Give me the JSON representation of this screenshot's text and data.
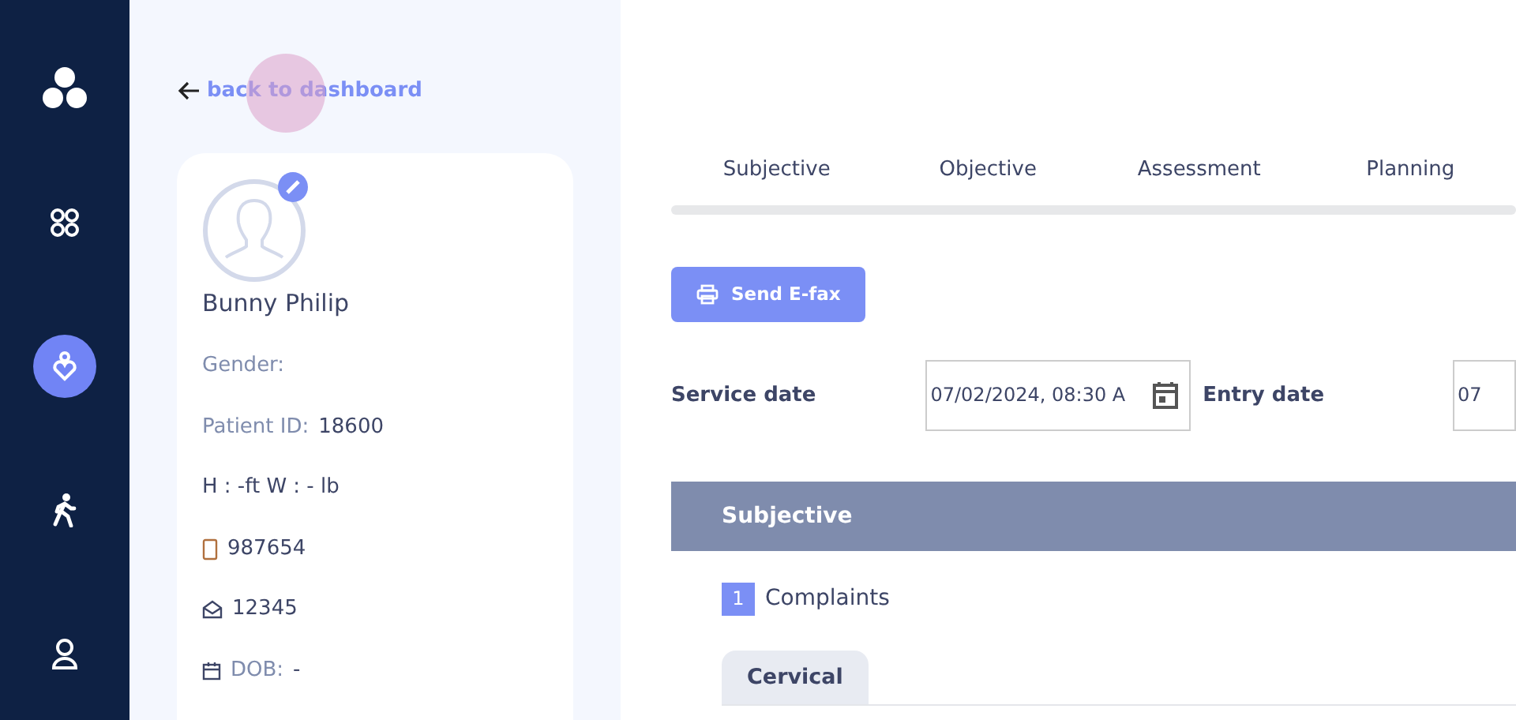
{
  "nav_rail": {
    "items": [
      {
        "kind": "grid",
        "selected": false
      },
      {
        "kind": "patient",
        "selected": true
      },
      {
        "kind": "walk",
        "selected": false
      },
      {
        "kind": "user",
        "selected": false
      }
    ]
  },
  "back_link": {
    "label": "back to dashboard",
    "click_indicator": true
  },
  "patient_card": {
    "name": "Bunny Philip",
    "gender_label": "Gender:",
    "id_label": "Patient ID:",
    "id_value": "18600",
    "height_weight": "H : -ft W : - lb",
    "phone": "987654",
    "postal": "12345",
    "dob_label": "DOB:",
    "dob_value": "-"
  },
  "tabs": [
    {
      "label": "Subjective",
      "selected": false
    },
    {
      "label": "Objective",
      "selected": false
    },
    {
      "label": "Assessment",
      "selected": false
    },
    {
      "label": "Planning",
      "selected": false
    }
  ],
  "send_button": "Send E-fax",
  "dates": [
    {
      "label": "Service date",
      "value": "07/02/2024, 08:30 A"
    },
    {
      "label": "Entry date",
      "value": "07"
    }
  ],
  "section": {
    "title": "Subjective",
    "items": [
      {
        "number": "1",
        "label": "Complaints",
        "subtabs": [
          {
            "label": "Cervical",
            "selected": true
          }
        ]
      }
    ]
  }
}
